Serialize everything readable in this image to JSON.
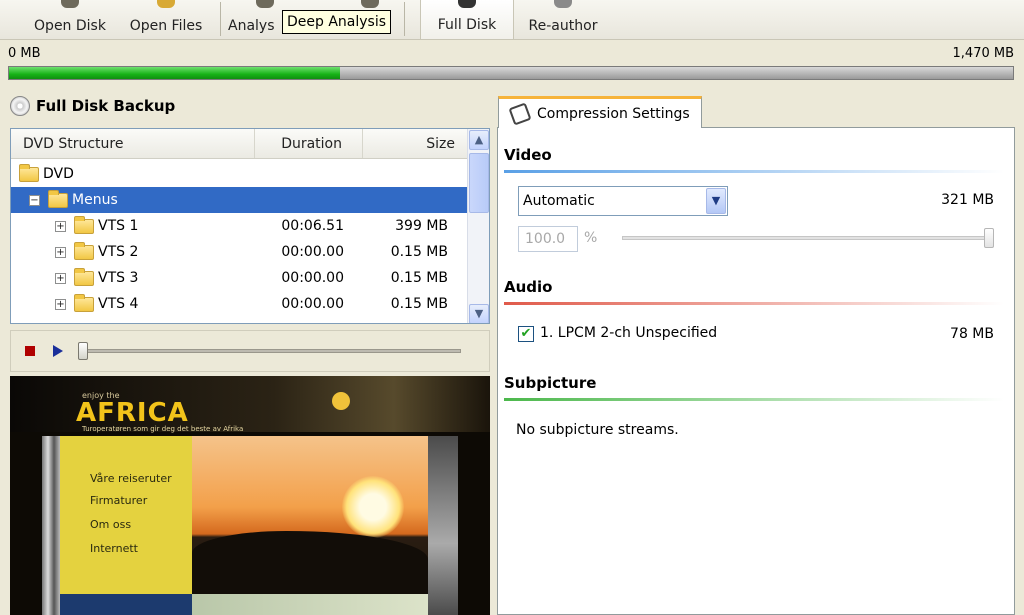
{
  "toolbar": {
    "open_disk": "Open Disk",
    "open_files": "Open Files",
    "analysis": "Analys",
    "full_disk": "Full Disk",
    "re_author": "Re-author"
  },
  "tooltip": "Deep Analysis",
  "capacity": {
    "min_label": "0 MB",
    "max_label": "1,470 MB",
    "fill_fraction": 0.33
  },
  "left_panel": {
    "title": "Full Disk Backup"
  },
  "tree": {
    "columns": [
      "DVD Structure",
      "Duration",
      "Size"
    ],
    "root": "DVD",
    "rows": [
      {
        "label": "Menus",
        "duration": "",
        "size": ""
      },
      {
        "label": "VTS 1",
        "duration": "00:06.51",
        "size": "399 MB"
      },
      {
        "label": "VTS 2",
        "duration": "00:00.00",
        "size": "0.15 MB"
      },
      {
        "label": "VTS 3",
        "duration": "00:00.00",
        "size": "0.15 MB"
      },
      {
        "label": "VTS 4",
        "duration": "00:00.00",
        "size": "0.15 MB"
      }
    ]
  },
  "preview": {
    "brand_top": "enjoy the",
    "brand": "AFRICA",
    "tagline": "Turoperatøren som gir deg det beste av Afrika",
    "menu": [
      "Våre reiseruter",
      "Firmaturer",
      "Om oss",
      "Internett"
    ]
  },
  "settings": {
    "tab_label": "Compression Settings",
    "video": {
      "title": "Video",
      "mode": "Automatic",
      "size": "321 MB",
      "percent": "100.0",
      "percent_unit": "%"
    },
    "audio": {
      "title": "Audio",
      "stream": "1. LPCM 2-ch Unspecified",
      "size": "78 MB",
      "checked": true
    },
    "subpicture": {
      "title": "Subpicture",
      "message": "No subpicture streams."
    }
  },
  "colors": {
    "selection": "#316ac5",
    "progress": "#17b317",
    "video_accent": "#5aa0e6",
    "audio_accent": "#e05a4a",
    "subpicture_accent": "#4cb84c",
    "tab_accent": "#f6b33a"
  }
}
